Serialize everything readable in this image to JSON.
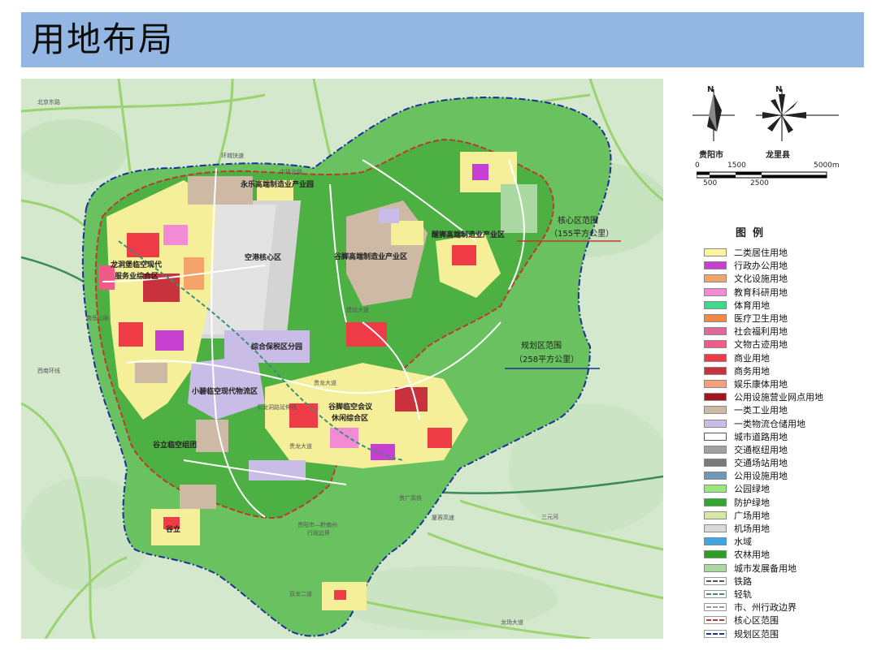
{
  "title": "用地布局",
  "map": {
    "labels": [
      {
        "id": "yongle",
        "text": "永乐高端制造业产业园"
      },
      {
        "id": "airport",
        "text": "空港核心区"
      },
      {
        "id": "longdongbao",
        "text": "龙洞堡临空现代"
      },
      {
        "id": "longdongbao2",
        "text": "服务业综合区"
      },
      {
        "id": "gujiao",
        "text": "谷脚高端制造业产业区"
      },
      {
        "id": "xingshi",
        "text": "醒狮高端制造业产业区"
      },
      {
        "id": "bonded",
        "text": "综合保税区分园"
      },
      {
        "id": "xiaobi",
        "text": "小碧临空现代物流区"
      },
      {
        "id": "gujiao_meeting",
        "text": "谷脚临空会议"
      },
      {
        "id": "gujiao_meeting2",
        "text": "休闲综合区"
      },
      {
        "id": "guli_group",
        "text": "谷立临空组团"
      },
      {
        "id": "guli",
        "text": "谷立"
      },
      {
        "id": "boundary",
        "text": "贵阳市—黔南州"
      },
      {
        "id": "boundary2",
        "text": "行政边界"
      }
    ],
    "roads": [
      {
        "id": "r1",
        "text": "北京东路"
      },
      {
        "id": "r2",
        "text": "环城快速"
      },
      {
        "id": "r3",
        "text": "中环北路"
      },
      {
        "id": "r4",
        "text": "贵龙大道"
      },
      {
        "id": "r5",
        "text": "贵龙大道"
      },
      {
        "id": "r6",
        "text": "贵广高铁"
      },
      {
        "id": "r7",
        "text": "厦蓉高速"
      },
      {
        "id": "r8",
        "text": "南岳山脉"
      },
      {
        "id": "r9",
        "text": "西南环线"
      },
      {
        "id": "r10",
        "text": "三元河"
      },
      {
        "id": "r11",
        "text": "龙场大道"
      },
      {
        "id": "r12",
        "text": "双龙二道"
      },
      {
        "id": "r13",
        "text": "建设大道"
      },
      {
        "id": "r14",
        "text": "贝龙洞路延伸线"
      }
    ],
    "callouts": {
      "core_title": "核心区范围",
      "core_area": "（155平方公里）",
      "plan_title": "规划区范围",
      "plan_area": "（258平方公里）"
    },
    "colors": {
      "plan_boundary": "#1c2f9c",
      "core_boundary": "#c0392b"
    }
  },
  "compass": {
    "left_label": "贵阳市",
    "right_label": "龙里县",
    "north": "N"
  },
  "scale": {
    "top": [
      "0",
      "1500",
      "5000m"
    ],
    "bottom": [
      "500",
      "2500"
    ]
  },
  "legend": {
    "title": "图例",
    "items": [
      {
        "label": "二类居住用地",
        "color": "#fff59a",
        "kind": "fill"
      },
      {
        "label": "行政办公用地",
        "color": "#c63fd0",
        "kind": "fill"
      },
      {
        "label": "文化设施用地",
        "color": "#f4a46a",
        "kind": "fill"
      },
      {
        "label": "教育科研用地",
        "color": "#f28ad4",
        "kind": "fill"
      },
      {
        "label": "体育用地",
        "color": "#3fd98e",
        "kind": "fill"
      },
      {
        "label": "医疗卫生用地",
        "color": "#f08a46",
        "kind": "fill"
      },
      {
        "label": "社会福利用地",
        "color": "#e26a9a",
        "kind": "fill"
      },
      {
        "label": "文物古迹用地",
        "color": "#f05a86",
        "kind": "fill"
      },
      {
        "label": "商业用地",
        "color": "#ee3b45",
        "kind": "fill"
      },
      {
        "label": "商务用地",
        "color": "#c8323c",
        "kind": "fill"
      },
      {
        "label": "娱乐康体用地",
        "color": "#f7a07a",
        "kind": "fill"
      },
      {
        "label": "公用设施营业网点用地",
        "color": "#a3141c",
        "kind": "fill"
      },
      {
        "label": "一类工业用地",
        "color": "#cdb9a4",
        "kind": "fill"
      },
      {
        "label": "一类物流仓储用地",
        "color": "#c9bde8",
        "kind": "fill"
      },
      {
        "label": "城市道路用地",
        "color": "#ffffff",
        "kind": "road"
      },
      {
        "label": "交通枢纽用地",
        "color": "#a0a0a0",
        "kind": "fill"
      },
      {
        "label": "交通场站用地",
        "color": "#7a7a7a",
        "kind": "fill"
      },
      {
        "label": "公用设施用地",
        "color": "#6e9ab8",
        "kind": "fill"
      },
      {
        "label": "公园绿地",
        "color": "#9be87a",
        "kind": "fill"
      },
      {
        "label": "防护绿地",
        "color": "#2fa82e",
        "kind": "fill"
      },
      {
        "label": "广场用地",
        "color": "#d7e8a4",
        "kind": "fill"
      },
      {
        "label": "机场用地",
        "color": "#d9d9d9",
        "kind": "fill"
      },
      {
        "label": "水域",
        "color": "#3aa8e8",
        "kind": "fill"
      },
      {
        "label": "农林用地",
        "color": "#27a21e",
        "kind": "fill"
      },
      {
        "label": "城市发展备用地",
        "color": "#a9d8a0",
        "kind": "fill"
      },
      {
        "label": "铁路",
        "color": "#555555",
        "kind": "line"
      },
      {
        "label": "轻轨",
        "color": "#3b8f7a",
        "kind": "line"
      },
      {
        "label": "市、州行政边界",
        "color": "#9a9a9a",
        "kind": "line"
      },
      {
        "label": "核心区范围",
        "color": "#c0392b",
        "kind": "line"
      },
      {
        "label": "规划区范围",
        "color": "#1c2f9c",
        "kind": "line"
      }
    ]
  }
}
